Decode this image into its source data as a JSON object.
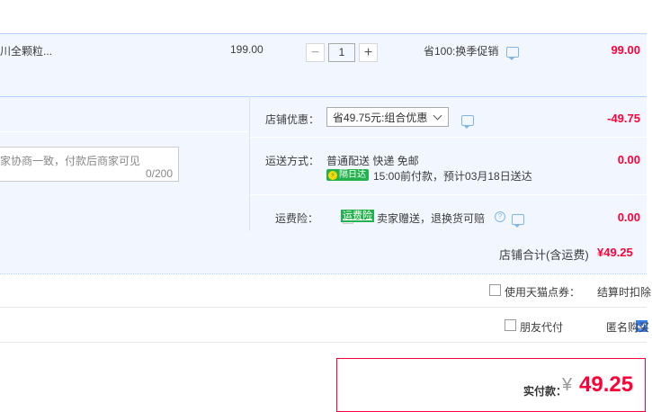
{
  "item": {
    "title": "川全颗粒...",
    "unit_price": "199.00",
    "quantity": "1",
    "promo": "省100:换季促销",
    "subtotal": "99.00"
  },
  "shop_discount": {
    "label": "店铺优惠：",
    "selected": "省49.75元:组合优惠",
    "amount": "-49.75"
  },
  "message": {
    "placeholder": "家协商一致，付款后商家可见",
    "counter": "0/200"
  },
  "shipping": {
    "label": "运送方式：",
    "method": "普通配送 快递 免邮",
    "badge": "隔日达",
    "eta": "15:00前付款，预计03月18日送达",
    "amount": "0.00"
  },
  "insurance": {
    "label": "运费险：",
    "badge": "运费险",
    "text": "卖家赠送，退换货可赔",
    "amount": "0.00"
  },
  "shop_total": {
    "label": "店铺合计(含运费)",
    "amount": "¥49.25"
  },
  "points": {
    "label": "使用天猫点券：",
    "note": "结算时扣除"
  },
  "options": {
    "friend_pay": "朋友代付",
    "anonymous": "匿名购买"
  },
  "payment": {
    "label": "实付款：",
    "currency": "¥",
    "amount": "49.25"
  },
  "colors": {
    "accent_red": "#ff0036",
    "checkbox_blue": "#3a7ff0",
    "band_blue": "#f2f7ff"
  }
}
